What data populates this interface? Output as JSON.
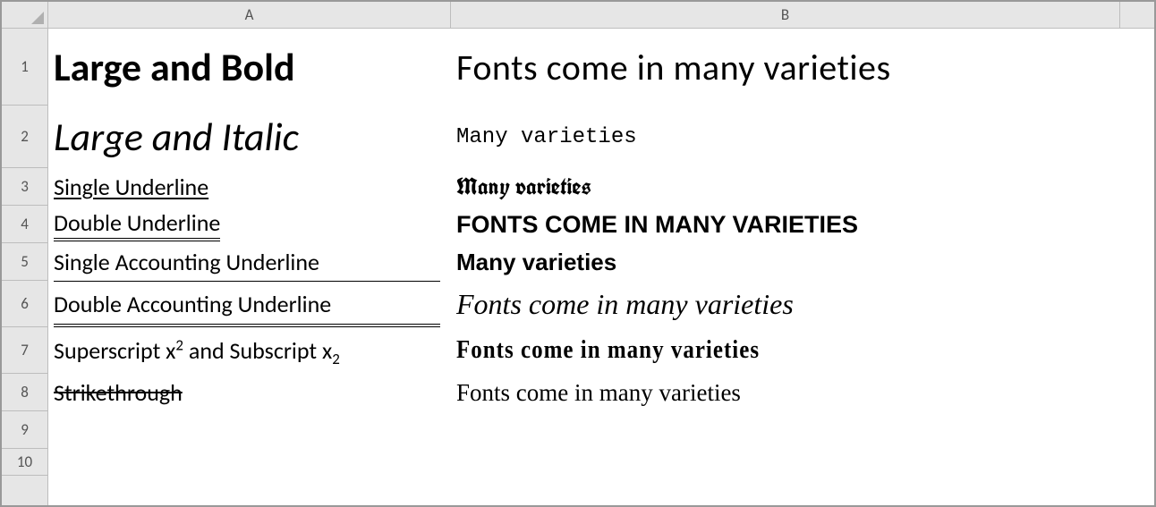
{
  "columns": {
    "A": "A",
    "B": "B"
  },
  "rowNumbers": [
    "1",
    "2",
    "3",
    "4",
    "5",
    "6",
    "7",
    "8",
    "9",
    "10"
  ],
  "cells": {
    "A1": "Large and Bold",
    "A2": "Large and Italic",
    "A3": "Single Underline",
    "A4": "Double Underline",
    "A5": "Single Accounting Underline",
    "A6": "Double Accounting Underline",
    "A7_pre": "Superscript x",
    "A7_sup": "2",
    "A7_mid": " and Subscript x",
    "A7_sub": "2",
    "A8": "Strikethrough",
    "B1": "Fonts come in many varieties",
    "B2": "Many varieties",
    "B3": "Many varieties",
    "B4": "FONTS COME IN MANY VARIETIES",
    "B5": "Many varieties",
    "B6": "Fonts come in many varieties",
    "B7": "Fonts come in many varieties",
    "B8": "Fonts come in many varieties"
  }
}
